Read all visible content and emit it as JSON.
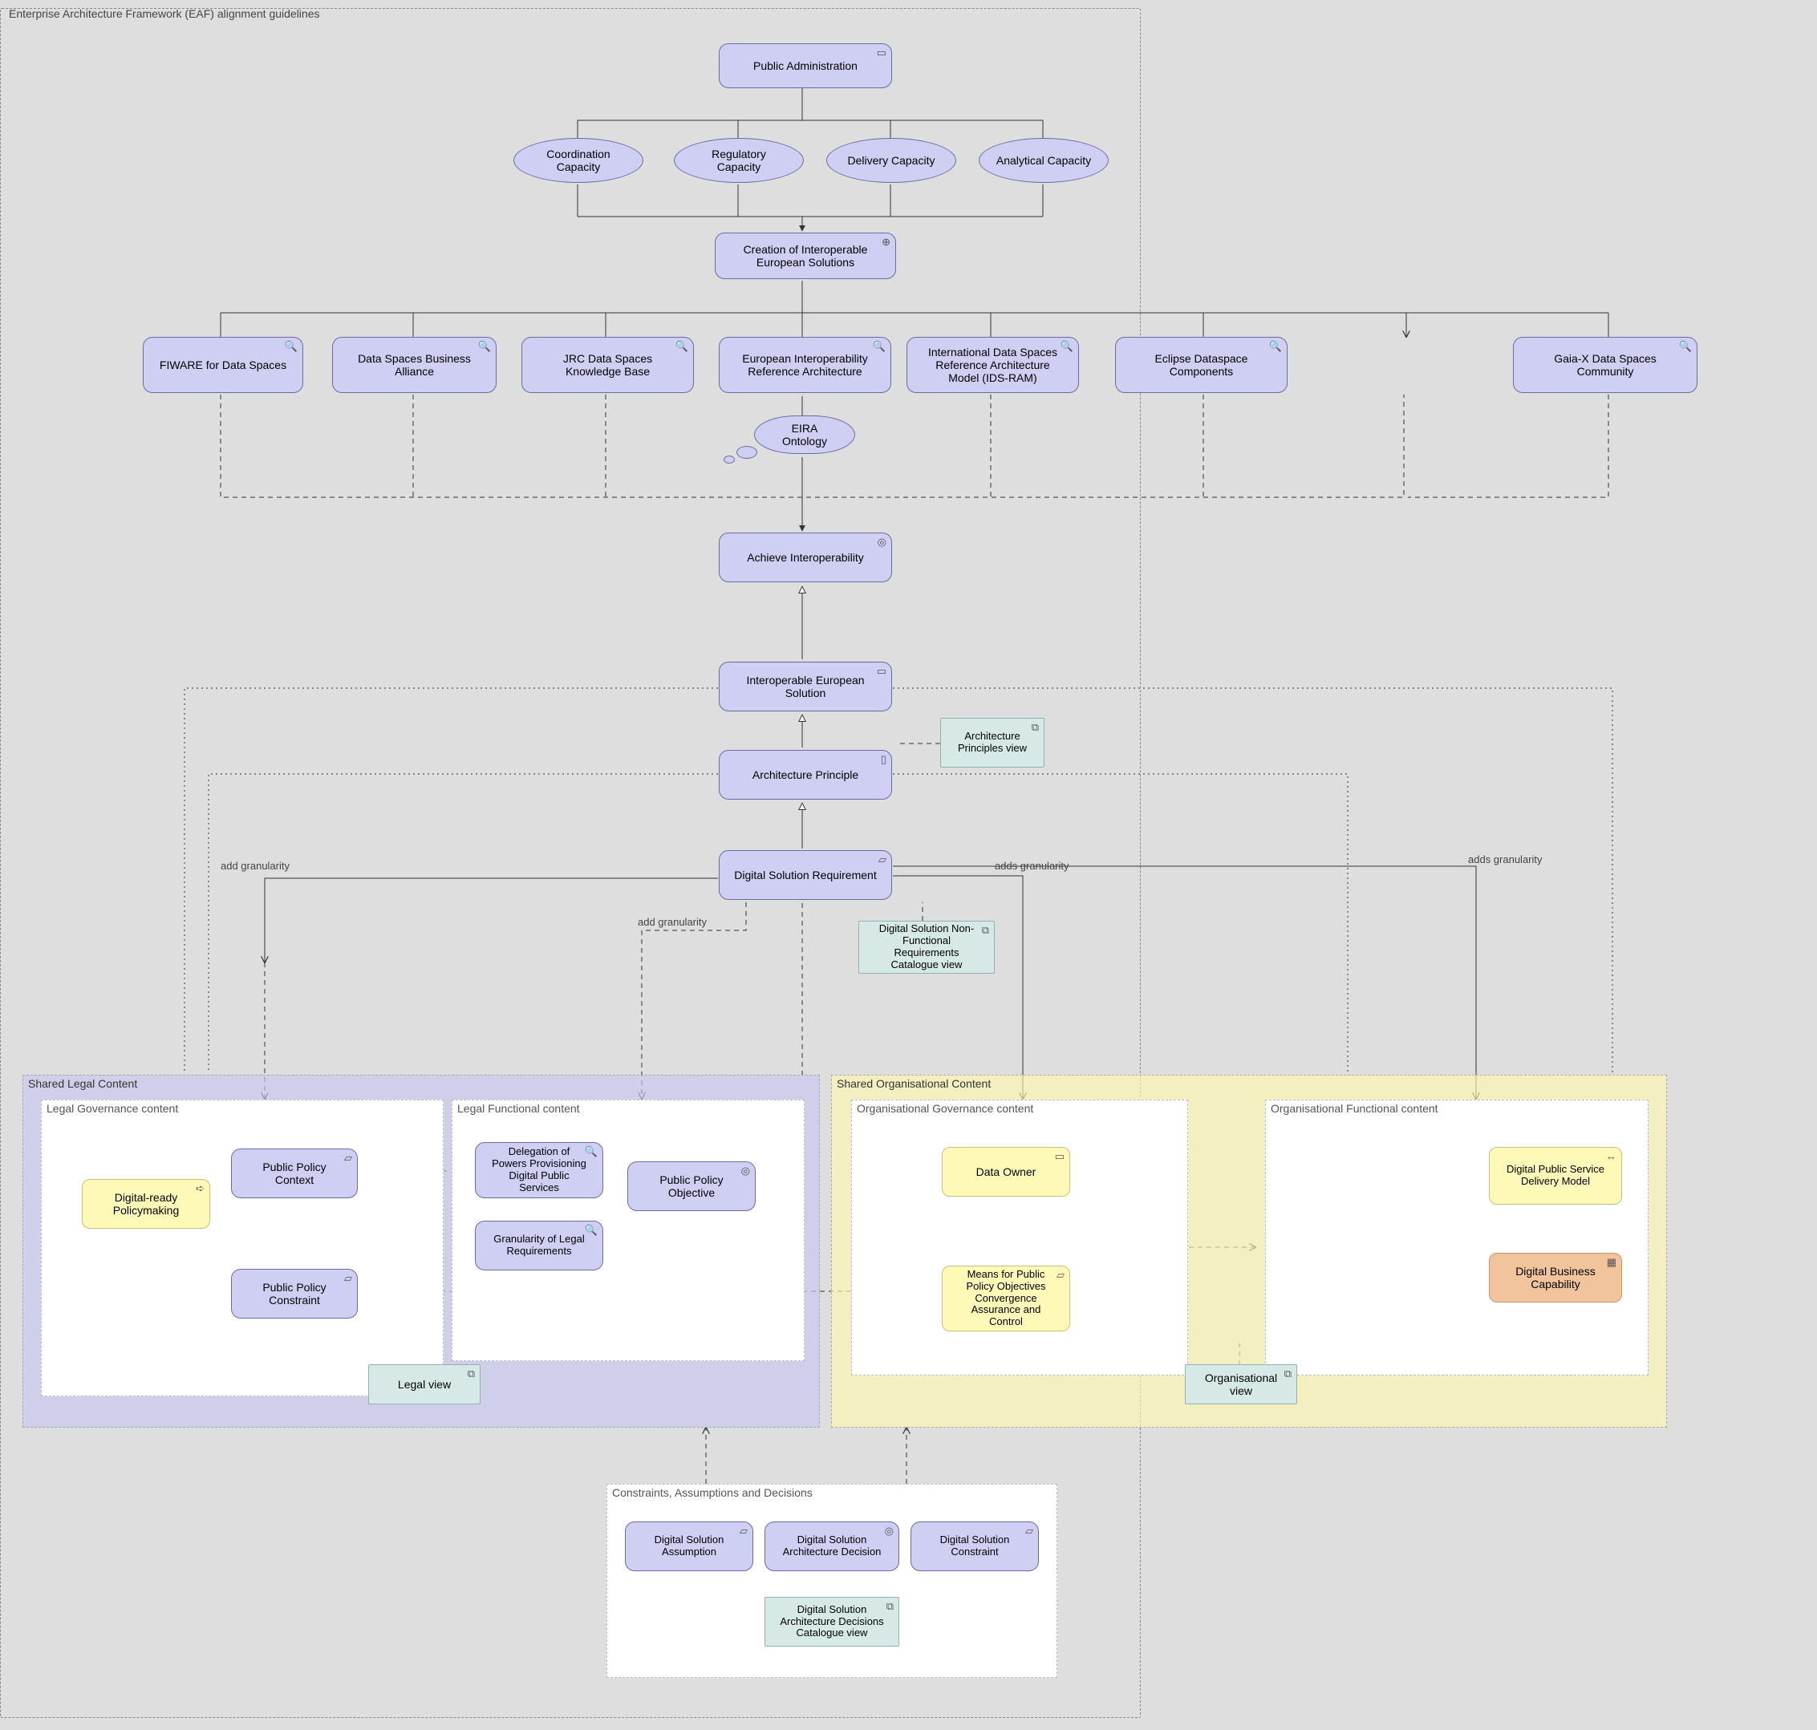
{
  "chart_data": {
    "type": "diagram",
    "framework_group": "Enterprise Architecture Framework (EAF) alignment guidelines",
    "central_flow": [
      "Public Administration",
      "Creation of Interoperable European Solutions",
      "Achieve Interoperability",
      "Interoperable European Solution",
      "Architecture Principle",
      "Digital Solution Requirement"
    ],
    "capacities": [
      "Coordination Capacity",
      "Regulatory Capacity",
      "Delivery Capacity",
      "Analytical Capacity"
    ],
    "reference_models_row": [
      "FIWARE for Data Spaces",
      "Data Spaces Business Alliance",
      "JRC Data Spaces Knowledge Base",
      "European Interoperability Reference Architecture",
      "International Data Spaces Reference Architecture Model (IDS-RAM)",
      "Eclipse Dataspace Components",
      "Gaia-X Data Spaces Community"
    ],
    "ontology": "EIRA Ontology",
    "side_views": [
      "Architecture Principles view",
      "Digital Solution Non-Functional Requirements Catalogue view"
    ],
    "shared_legal_content": {
      "title": "Shared Legal Content",
      "governance": {
        "title": "Legal Governance content",
        "items": [
          "Digital-ready Policymaking",
          "Public Policy Context",
          "Public Policy Constraint"
        ],
        "view": "Legal view"
      },
      "functional": {
        "title": "Legal Functional content",
        "items": [
          "Delegation of Powers Provisioning Digital Public Services",
          "Granularity of Legal Requirements",
          "Public Policy Objective"
        ]
      }
    },
    "shared_organisational_content": {
      "title": "Shared Organisational Content",
      "governance": {
        "title": "Organisational Governance content",
        "items": [
          "Data Owner",
          "Means for Public Policy Objectives Convergence Assurance and Control"
        ],
        "view": "Organisational view"
      },
      "functional": {
        "title": "Organisational Functional content",
        "items": [
          "Digital Public Service Delivery Model",
          "Digital Business Capability"
        ]
      }
    },
    "constraints_panel": {
      "title": "Constraints, Assumptions and Decisions",
      "items": [
        "Digital Solution Assumption",
        "Digital Solution Architecture Decision",
        "Digital Solution Constraint"
      ],
      "view": "Digital Solution Architecture Decisions Catalogue view"
    },
    "edge_labels": {
      "add_granularity": "add granularity",
      "adds_granularity": "adds granularity"
    }
  },
  "eaf_group": "Enterprise Architecture Framework (EAF) alignment guidelines",
  "top": {
    "public_admin": "Public Administration",
    "capacities": {
      "coord": "Coordination Capacity",
      "reg": "Regulatory Capacity",
      "del": "Delivery Capacity",
      "ana": "Analytical Capacity"
    },
    "creation": "Creation of Interoperable European Solutions"
  },
  "row": {
    "fiware": "FIWARE for Data Spaces",
    "dsba": "Data Spaces Business Alliance",
    "jrc": "JRC Data Spaces Knowledge Base",
    "eira_ref": "European Interoperability Reference Architecture",
    "ids": "International Data Spaces Reference Architecture Model (IDS-RAM)",
    "eclipse": "Eclipse Dataspace Components",
    "gaiax": "Gaia-X Data Spaces Community"
  },
  "ontology": "EIRA Ontology",
  "flow": {
    "achieve": "Achieve Interoperability",
    "ies": "Interoperable European Solution",
    "principle": "Architecture Principle",
    "requirement": "Digital Solution Requirement"
  },
  "views": {
    "arch_principles": "Architecture Principles view",
    "nfr": "Digital Solution Non-Functional Requirements Catalogue view"
  },
  "legal": {
    "title": "Shared Legal Content",
    "gov_title": "Legal Governance content",
    "func_title": "Legal Functional content",
    "policymaking": "Digital-ready Policymaking",
    "context": "Public Policy Context",
    "constraint": "Public Policy Constraint",
    "delegation": "Delegation of Powers Provisioning Digital Public Services",
    "granularity": "Granularity of Legal Requirements",
    "objective": "Public Policy Objective",
    "view": "Legal view"
  },
  "org": {
    "title": "Shared Organisational Content",
    "gov_title": "Organisational Governance content",
    "func_title": "Organisational Functional content",
    "owner": "Data Owner",
    "means": "Means for Public Policy Objectives Convergence Assurance and Control",
    "delivery": "Digital Public Service Delivery Model",
    "capability": "Digital Business Capability",
    "view": "Organisational view"
  },
  "dec": {
    "title": "Constraints, Assumptions and Decisions",
    "assumption": "Digital Solution Assumption",
    "decision": "Digital Solution Architecture Decision",
    "constraint": "Digital Solution Constraint",
    "view": "Digital Solution Architecture Decisions Catalogue view"
  },
  "labels": {
    "add_gran": "add granularity",
    "adds_gran": "adds granularity"
  }
}
